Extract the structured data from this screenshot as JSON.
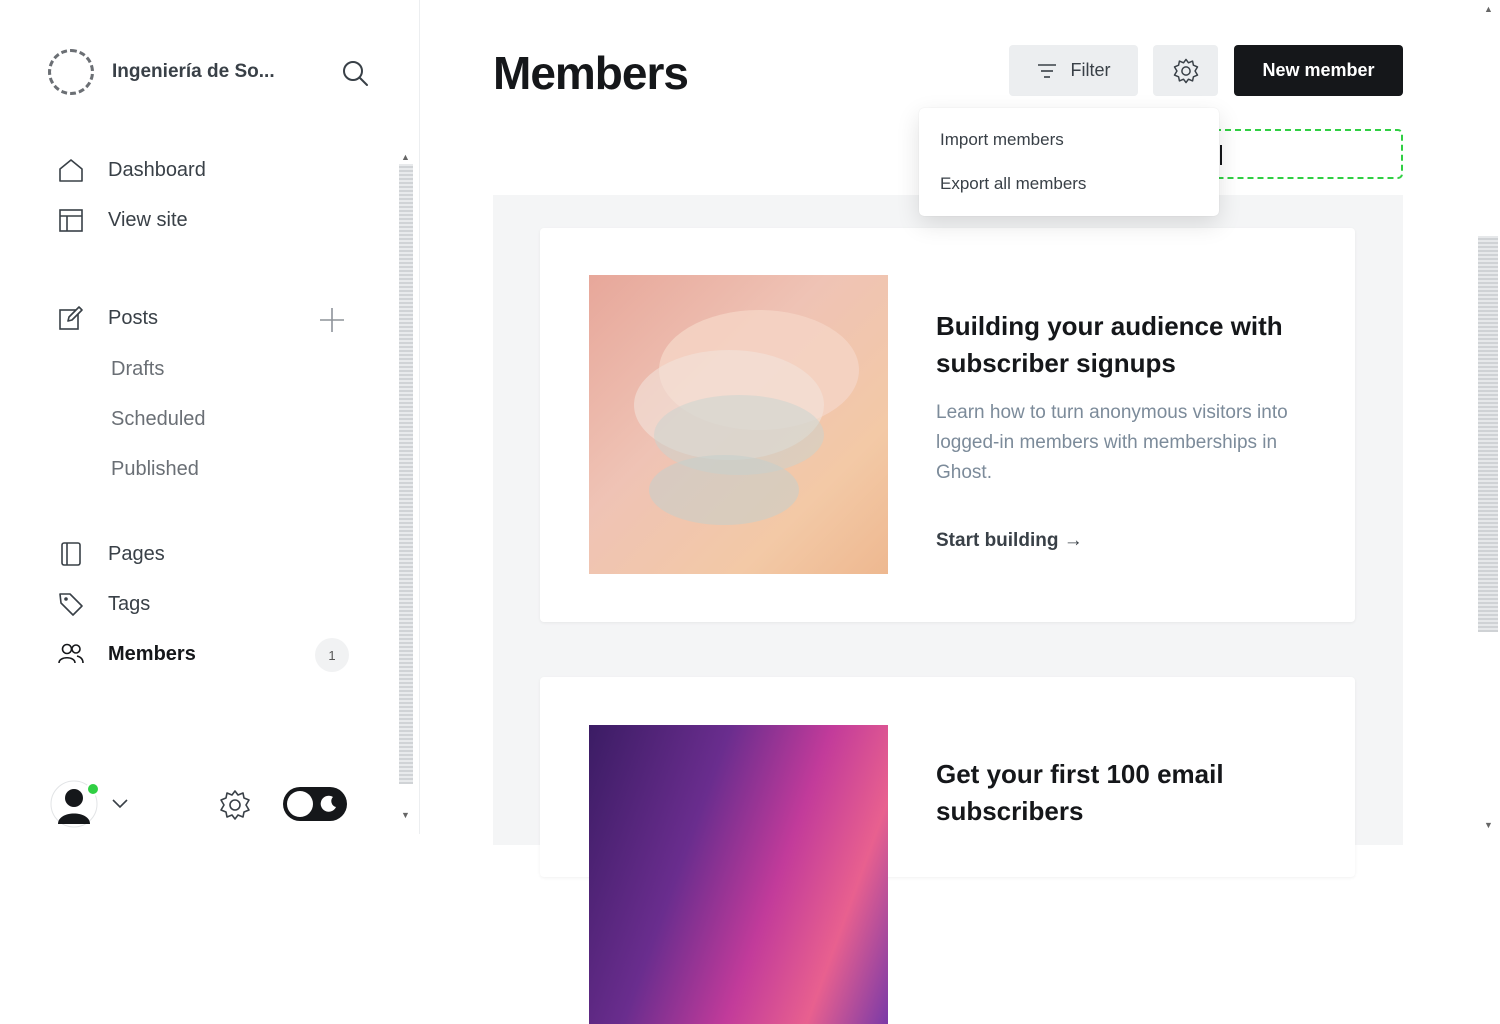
{
  "sidebar": {
    "site_name": "Ingeniería de So...",
    "nav": {
      "dashboard": "Dashboard",
      "view_site": "View site",
      "posts": "Posts",
      "drafts": "Drafts",
      "scheduled": "Scheduled",
      "published": "Published",
      "pages": "Pages",
      "tags": "Tags",
      "members": "Members",
      "members_count": "1"
    }
  },
  "header": {
    "title": "Members",
    "filter_label": "Filter",
    "new_member_label": "New member"
  },
  "dropdown": {
    "import_label": "Import members",
    "export_label": "Export all members"
  },
  "cards": [
    {
      "title": "Building your audience with subscriber signups",
      "description": "Learn how to turn anonymous visitors into logged-in members with memberships in Ghost.",
      "link": "Start building →"
    },
    {
      "title": "Get your first 100 email subscribers"
    }
  ],
  "colors": {
    "accent_green": "#30cf43",
    "primary_dark": "#15171a",
    "button_grey": "#eceef0"
  }
}
